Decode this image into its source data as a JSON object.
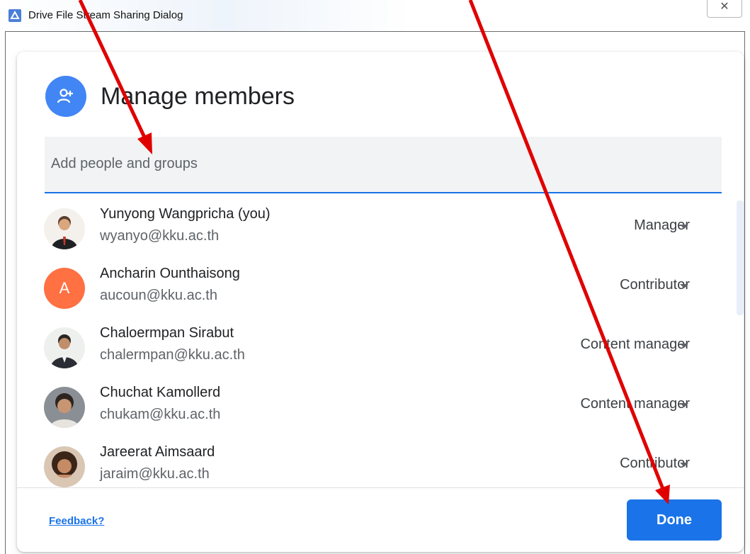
{
  "window": {
    "title": "Drive File Stream Sharing Dialog",
    "close_glyph": "✕"
  },
  "dialog": {
    "title": "Manage members",
    "header_icon": "person-add-icon",
    "add_placeholder": "Add people and groups"
  },
  "members": [
    {
      "name": "Yunyong Wangpricha (you)",
      "email": "wyanyo@kku.ac.th",
      "role": "Manager",
      "avatar": "photo"
    },
    {
      "name": "Ancharin Ounthaisong",
      "email": "aucoun@kku.ac.th",
      "role": "Contributor",
      "avatar": "A",
      "avatar_color": "#ff7043"
    },
    {
      "name": "Chaloermpan Sirabut",
      "email": "chalermpan@kku.ac.th",
      "role": "Content manager",
      "avatar": "photo"
    },
    {
      "name": "Chuchat Kamollerd",
      "email": "chukam@kku.ac.th",
      "role": "Content manager",
      "avatar": "photo"
    },
    {
      "name": "Jareerat Aimsaard",
      "email": "jaraim@kku.ac.th",
      "role": "Contributor",
      "avatar": "photo"
    }
  ],
  "footer": {
    "feedback": "Feedback?",
    "done": "Done"
  },
  "colors": {
    "accent": "#1a73e8",
    "annotation_arrow": "#e00000"
  }
}
